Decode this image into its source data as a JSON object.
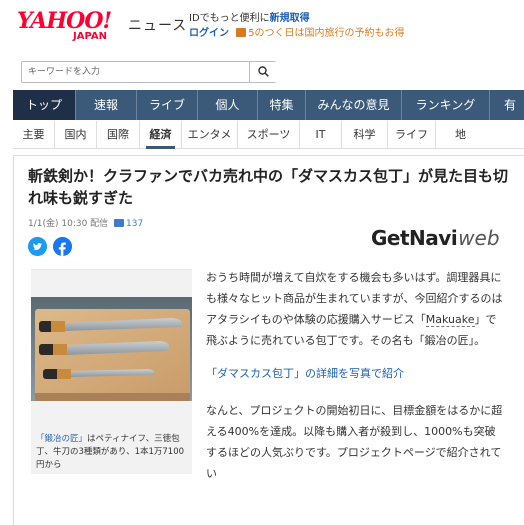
{
  "header": {
    "logo_yahoo": "YAHOO!",
    "logo_japan": "JAPAN",
    "logo_news": "ニュース",
    "promo_line1_prefix": "IDでもっと便利に",
    "promo_line1_bold": "新規取得",
    "promo_login": "ログイン",
    "promo_hint": "5のつく日は国内旅行の予約もお得"
  },
  "search": {
    "placeholder": "キーワードを入力"
  },
  "main_nav": [
    "トップ",
    "速報",
    "ライブ",
    "個人",
    "特集",
    "みんなの意見",
    "ランキング",
    "有"
  ],
  "sub_nav": [
    "主要",
    "国内",
    "国際",
    "経済",
    "エンタメ",
    "スポーツ",
    "IT",
    "科学",
    "ライフ",
    "地"
  ],
  "article": {
    "title": "斬鉄剣か！クラファンでバカ売れ中の「ダマスカス包丁」が見た目も切れ味も鋭すぎた",
    "date": "1/1(金) 10:30 配信",
    "comment_count": "137",
    "brand_main": "GetNavi",
    "brand_sub": "web",
    "caption_highlight": "「鍛冶の匠」",
    "caption_rest": "はペティナイフ、三徳包丁、牛刀の3種類があり、1本1万7100円から",
    "para1_a": "おうち時間が増えて自炊をする機会も多いはず。調理器具にも様々なヒット商品が生まれていますが、今回紹介するのはアタラシイものや体験の応援購入サービス「",
    "para1_makuake": "Makuake",
    "para1_b": "」で飛ぶように売れている包丁です。その名も「鍛冶の匠」。",
    "link_text": "「ダマスカス包丁」の詳細を写真で紹介",
    "para2_a": "なんと、プロジェクトの開始初日に、目標金額をはるかに超える400%を達成。以降も購入者が殺到し、1000%も突破するほどの人気ぶりです。プロジェクトページで紹介されてい"
  },
  "colors": {
    "nav_bg": "#3b5a7a",
    "nav_active": "#1e2f47",
    "link": "#1e60b0",
    "yahoo_red": "#ff0033"
  }
}
